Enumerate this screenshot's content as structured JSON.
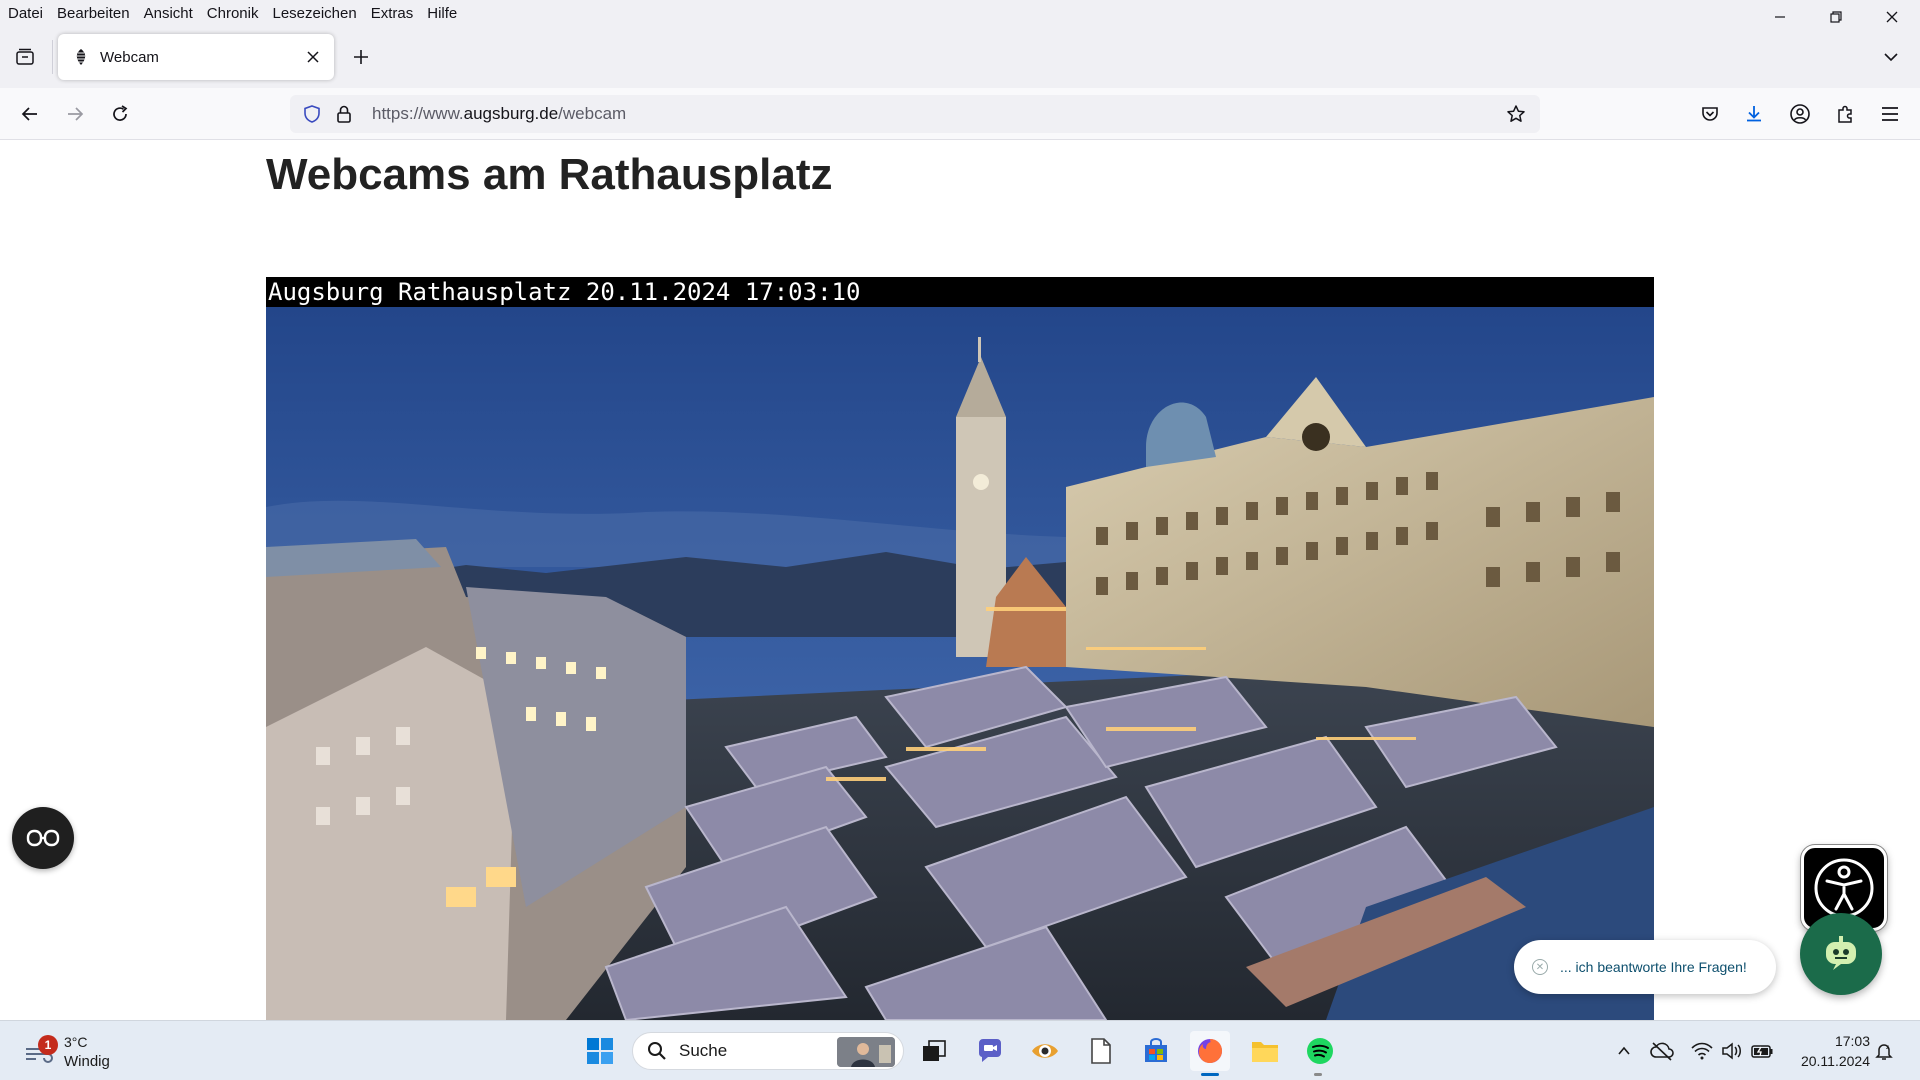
{
  "browser": {
    "menu": [
      "Datei",
      "Bearbeiten",
      "Ansicht",
      "Chronik",
      "Lesezeichen",
      "Extras",
      "Hilfe"
    ],
    "tab": {
      "title": "Webcam",
      "favicon": "pinecone-icon"
    },
    "url": {
      "prefix": "https://www.",
      "domain": "augsburg.de",
      "path": "/webcam"
    }
  },
  "page": {
    "title": "Webcams am Rathausplatz",
    "webcam": {
      "caption": "Augsburg Rathausplatz 20.11.2024 17:03:10",
      "scene": "Augsburg Rathausplatz Christkindlesmarkt at dusk"
    },
    "chat": {
      "message": "... ich beantworte Ihre Fragen!"
    }
  },
  "taskbar": {
    "weather": {
      "temp": "3°C",
      "condition": "Windig",
      "badge": "1"
    },
    "search": {
      "label": "Suche"
    },
    "clock": {
      "time": "17:03",
      "date": "20.11.2024"
    }
  },
  "colors": {
    "accent": "#0067c0",
    "sky": "#2b4a86",
    "chat_green": "#1b6b4a"
  }
}
